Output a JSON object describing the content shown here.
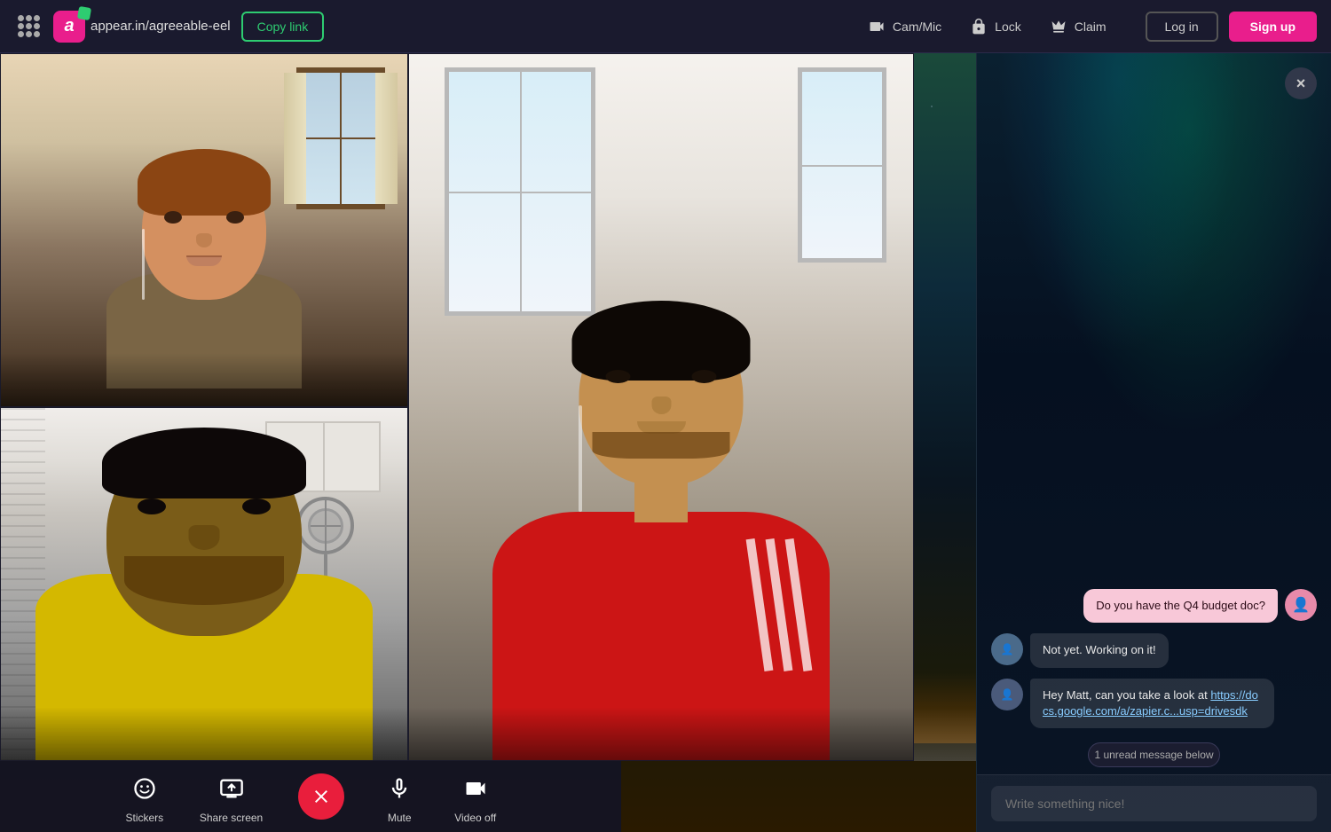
{
  "topbar": {
    "logo_letter": "a",
    "url_text": "appear.in/agreeable-eel",
    "copy_link_label": "Copy link",
    "actions": [
      {
        "id": "cam-mic",
        "label": "Cam/Mic",
        "icon": "camera"
      },
      {
        "id": "lock",
        "label": "Lock",
        "icon": "lock"
      },
      {
        "id": "claim",
        "label": "Claim",
        "icon": "crown"
      }
    ],
    "login_label": "Log in",
    "signup_label": "Sign up"
  },
  "toolbar": {
    "stickers_label": "Stickers",
    "share_screen_label": "Share screen",
    "mute_label": "Mute",
    "video_off_label": "Video off"
  },
  "chat": {
    "close_label": "×",
    "messages": [
      {
        "id": 1,
        "type": "outgoing",
        "text": "Do you have the Q4 budget doc?",
        "avatar_bg": "#d4708a"
      },
      {
        "id": 2,
        "type": "incoming",
        "text": "Not yet. Working on it!",
        "avatar_bg": "#5a7a9a"
      },
      {
        "id": 3,
        "type": "incoming",
        "text": "Hey Matt, can you take a look at ",
        "link_text": "https://docs.google.com/a/zapier.c...usp=drivesdk",
        "avatar_bg": "#5a6a8a"
      }
    ],
    "unread_banner": "1 unread message below",
    "input_placeholder": "Write something nice!"
  }
}
